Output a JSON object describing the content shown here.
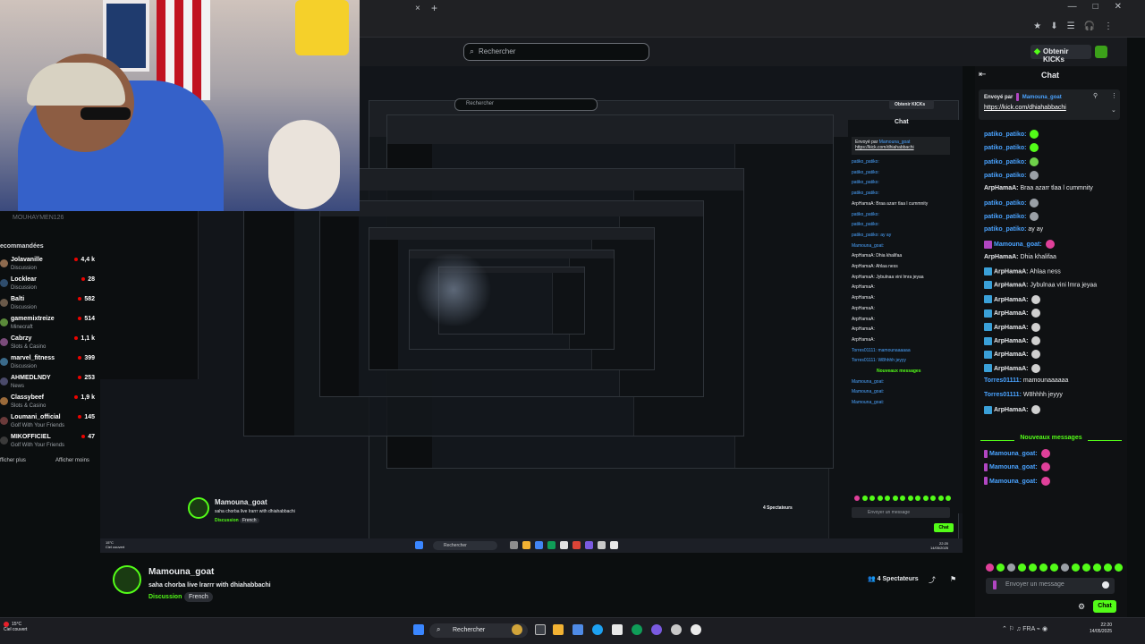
{
  "browser": {
    "tab_close": "×",
    "new_tab": "+",
    "window_controls": [
      "—",
      "□",
      "✕"
    ],
    "toolbar_icons": [
      "★",
      "⬇",
      "☰",
      "🎧",
      "⋮"
    ]
  },
  "header": {
    "search_placeholder": "Rechercher",
    "kicks_button": "Obtenir KICKs"
  },
  "sidebar": {
    "user": "MOUHAYMEN126",
    "section_title": "ecommandées",
    "channels": [
      {
        "name": "Jolavanille",
        "category": "Discussion",
        "viewers": "4,4 k",
        "color": "#8e6b4f"
      },
      {
        "name": "Locklear",
        "category": "Discussion",
        "viewers": "28",
        "color": "#2f4d6d"
      },
      {
        "name": "Balti",
        "category": "Discussion",
        "viewers": "582",
        "color": "#6a5a4a"
      },
      {
        "name": "gamemixtreize",
        "category": "Minecraft",
        "viewers": "514",
        "color": "#5b8a3a"
      },
      {
        "name": "Cabrzy",
        "category": "Slots & Casino",
        "viewers": "1,1 k",
        "color": "#7a4b7a"
      },
      {
        "name": "marvel_fitness",
        "category": "Discussion",
        "viewers": "399",
        "color": "#3a6a8a"
      },
      {
        "name": "AHMEDLNDY",
        "category": "News",
        "viewers": "253",
        "color": "#4a4a6a"
      },
      {
        "name": "Classybeef",
        "category": "Slots & Casino",
        "viewers": "1,9 k",
        "color": "#9a6a3a"
      },
      {
        "name": "Loumani_official",
        "category": "Golf With Your Friends",
        "viewers": "145",
        "color": "#6a3a3a"
      },
      {
        "name": "MIKOFFICIEL",
        "category": "Golf With Your Friends",
        "viewers": "47",
        "color": "#3a3a3a"
      }
    ],
    "show_more": "fficher plus",
    "show_less": "Afficher moins"
  },
  "chat": {
    "title": "Chat",
    "pinned_by_prefix": "Envoyé par",
    "pinned_user": "Mamouna_goat",
    "pinned_link": "https://kick.com/dhiahabbachi",
    "messages": [
      {
        "user": "patiko_patiko:",
        "text": "",
        "color": "#4aa3ff",
        "emote": "#53fc18",
        "badge": ""
      },
      {
        "user": "patiko_patiko:",
        "text": "",
        "color": "#4aa3ff",
        "emote": "#53fc18",
        "badge": ""
      },
      {
        "user": "patiko_patiko:",
        "text": "",
        "color": "#4aa3ff",
        "emote": "#6fd14a",
        "badge": ""
      },
      {
        "user": "patiko_patiko:",
        "text": "",
        "color": "#4aa3ff",
        "emote": "#9aa0a6",
        "badge": ""
      },
      {
        "user": "ArpHamaA:",
        "text": "Braa azarr tlaa l cummnity",
        "color": "#e8eaed",
        "emote": "",
        "badge": ""
      },
      {
        "user": "patiko_patiko:",
        "text": "",
        "color": "#4aa3ff",
        "emote": "#9aa0a6",
        "badge": ""
      },
      {
        "user": "patiko_patiko:",
        "text": "",
        "color": "#4aa3ff",
        "emote": "#9aa0a6",
        "badge": ""
      },
      {
        "user": "patiko_patiko:",
        "text": "ay ay",
        "color": "#4aa3ff",
        "emote": "",
        "badge": ""
      },
      {
        "user": "Mamouna_goat:",
        "text": "",
        "color": "#4aa3ff",
        "emote": "#e0409a",
        "badge": "#b146c2"
      },
      {
        "user": "ArpHamaA:",
        "text": "Dhia khalifaa",
        "color": "#e8eaed",
        "emote": "",
        "badge": ""
      },
      {
        "user": "ArpHamaA:",
        "text": "Ahlaa ness",
        "color": "#e8eaed",
        "emote": "",
        "badge": "#3aa0d8"
      },
      {
        "user": "ArpHamaA:",
        "text": "Jybulnaa vini lmra jeyaa",
        "color": "#e8eaed",
        "emote": "",
        "badge": "#3aa0d8"
      },
      {
        "user": "ArpHamaA:",
        "text": "",
        "color": "#e8eaed",
        "emote": "#d0d0d0",
        "badge": "#3aa0d8"
      },
      {
        "user": "ArpHamaA:",
        "text": "",
        "color": "#e8eaed",
        "emote": "#d0d0d0",
        "badge": "#3aa0d8"
      },
      {
        "user": "ArpHamaA:",
        "text": "",
        "color": "#e8eaed",
        "emote": "#d0d0d0",
        "badge": "#3aa0d8"
      },
      {
        "user": "ArpHamaA:",
        "text": "",
        "color": "#e8eaed",
        "emote": "#d0d0d0",
        "badge": "#3aa0d8"
      },
      {
        "user": "ArpHamaA:",
        "text": "",
        "color": "#e8eaed",
        "emote": "#d0d0d0",
        "badge": "#3aa0d8"
      },
      {
        "user": "ArpHamaA:",
        "text": "",
        "color": "#e8eaed",
        "emote": "#d0d0d0",
        "badge": "#3aa0d8"
      },
      {
        "user": "Torres01111:",
        "text": "mamounaaaaaa",
        "color": "#4aa3ff",
        "emote": "",
        "badge": ""
      },
      {
        "user": "Torres01111:",
        "text": "W8hhhh jeyyy",
        "color": "#4aa3ff",
        "emote": "",
        "badge": ""
      },
      {
        "user": "ArpHamaA:",
        "text": "",
        "color": "#e8eaed",
        "emote": "#d0d0d0",
        "badge": "#3aa0d8"
      }
    ],
    "new_messages_label": "Nouveaux messages",
    "new_messages": [
      {
        "user": "Mamouna_goat:",
        "emote": "#e0409a"
      },
      {
        "user": "Mamouna_goat:",
        "emote": "#e0409a"
      },
      {
        "user": "Mamouna_goat:",
        "emote": "#e0409a"
      }
    ],
    "emote_bar": [
      "#e0409a",
      "#53fc18",
      "#9aa0a6",
      "#53fc18",
      "#53fc18",
      "#53fc18",
      "#53fc18",
      "#9aa0a6",
      "#53fc18",
      "#53fc18",
      "#53fc18",
      "#53fc18",
      "#53fc18"
    ],
    "input_placeholder": "Envoyer un message",
    "send_button": "Chat"
  },
  "stream": {
    "streamer": "Mamouna_goat",
    "title": "saha chorba live lrarrr with dhiahabbachi",
    "category": "Discussion",
    "language": "French",
    "viewers": "4 Spectateurs"
  },
  "inner": {
    "search_placeholder": "Rechercher",
    "kicks_button": "Obtenir KICKs",
    "chat_title": "Chat",
    "pinned_by": "Envoyé par",
    "pinned_user": "Mamouna_goat",
    "pinned_link": "https://kick.com/dhiahabbachi",
    "messages": [
      "patiko_patiko:",
      "patiko_patiko:",
      "patiko_patiko:",
      "patiko_patiko:",
      "ArpHamaA: Braa azarr tlaa l cummnity",
      "patiko_patiko:",
      "patiko_patiko:",
      "patiko_patiko: ay ay",
      "Mamouna_goat:",
      "ArpHamaA: Dhia khalifaa",
      "ArpHamaA: Ahlaa ness",
      "ArpHamaA: Jybulnaa vini lmra jeyaa",
      "ArpHamaA:",
      "ArpHamaA:",
      "ArpHamaA:",
      "ArpHamaA:",
      "ArpHamaA:",
      "ArpHamaA:",
      "Torres01111: mamounaaaaaa",
      "Torres01111: W8hhhh jeyyy",
      "Nouveaux messages",
      "Mamouna_goat:",
      "Mamouna_goat:",
      "Mamouna_goat:"
    ],
    "streamer": "Mamouna_goat",
    "title": "saha chorba live lrarrr with dhiahabbachi",
    "category": "Discussion",
    "language": "French",
    "viewers": "4 Spectateurs",
    "input_placeholder": "Envoyer un message",
    "send_button": "Chat",
    "taskbar_search": "Rechercher",
    "taskbar_weather_temp": "15°C",
    "taskbar_weather_text": "Ciel couvert",
    "clock_time": "22:20",
    "clock_date": "14/05/2025"
  },
  "taskbar": {
    "weather_temp": "15°C",
    "weather_text": "Ciel couvert",
    "search_label": "Rechercher",
    "lang": "FRA",
    "time": "22:20",
    "date": "14/05/2025"
  },
  "colors": {
    "brand": "#53fc18",
    "background": "#0b0e0f"
  }
}
